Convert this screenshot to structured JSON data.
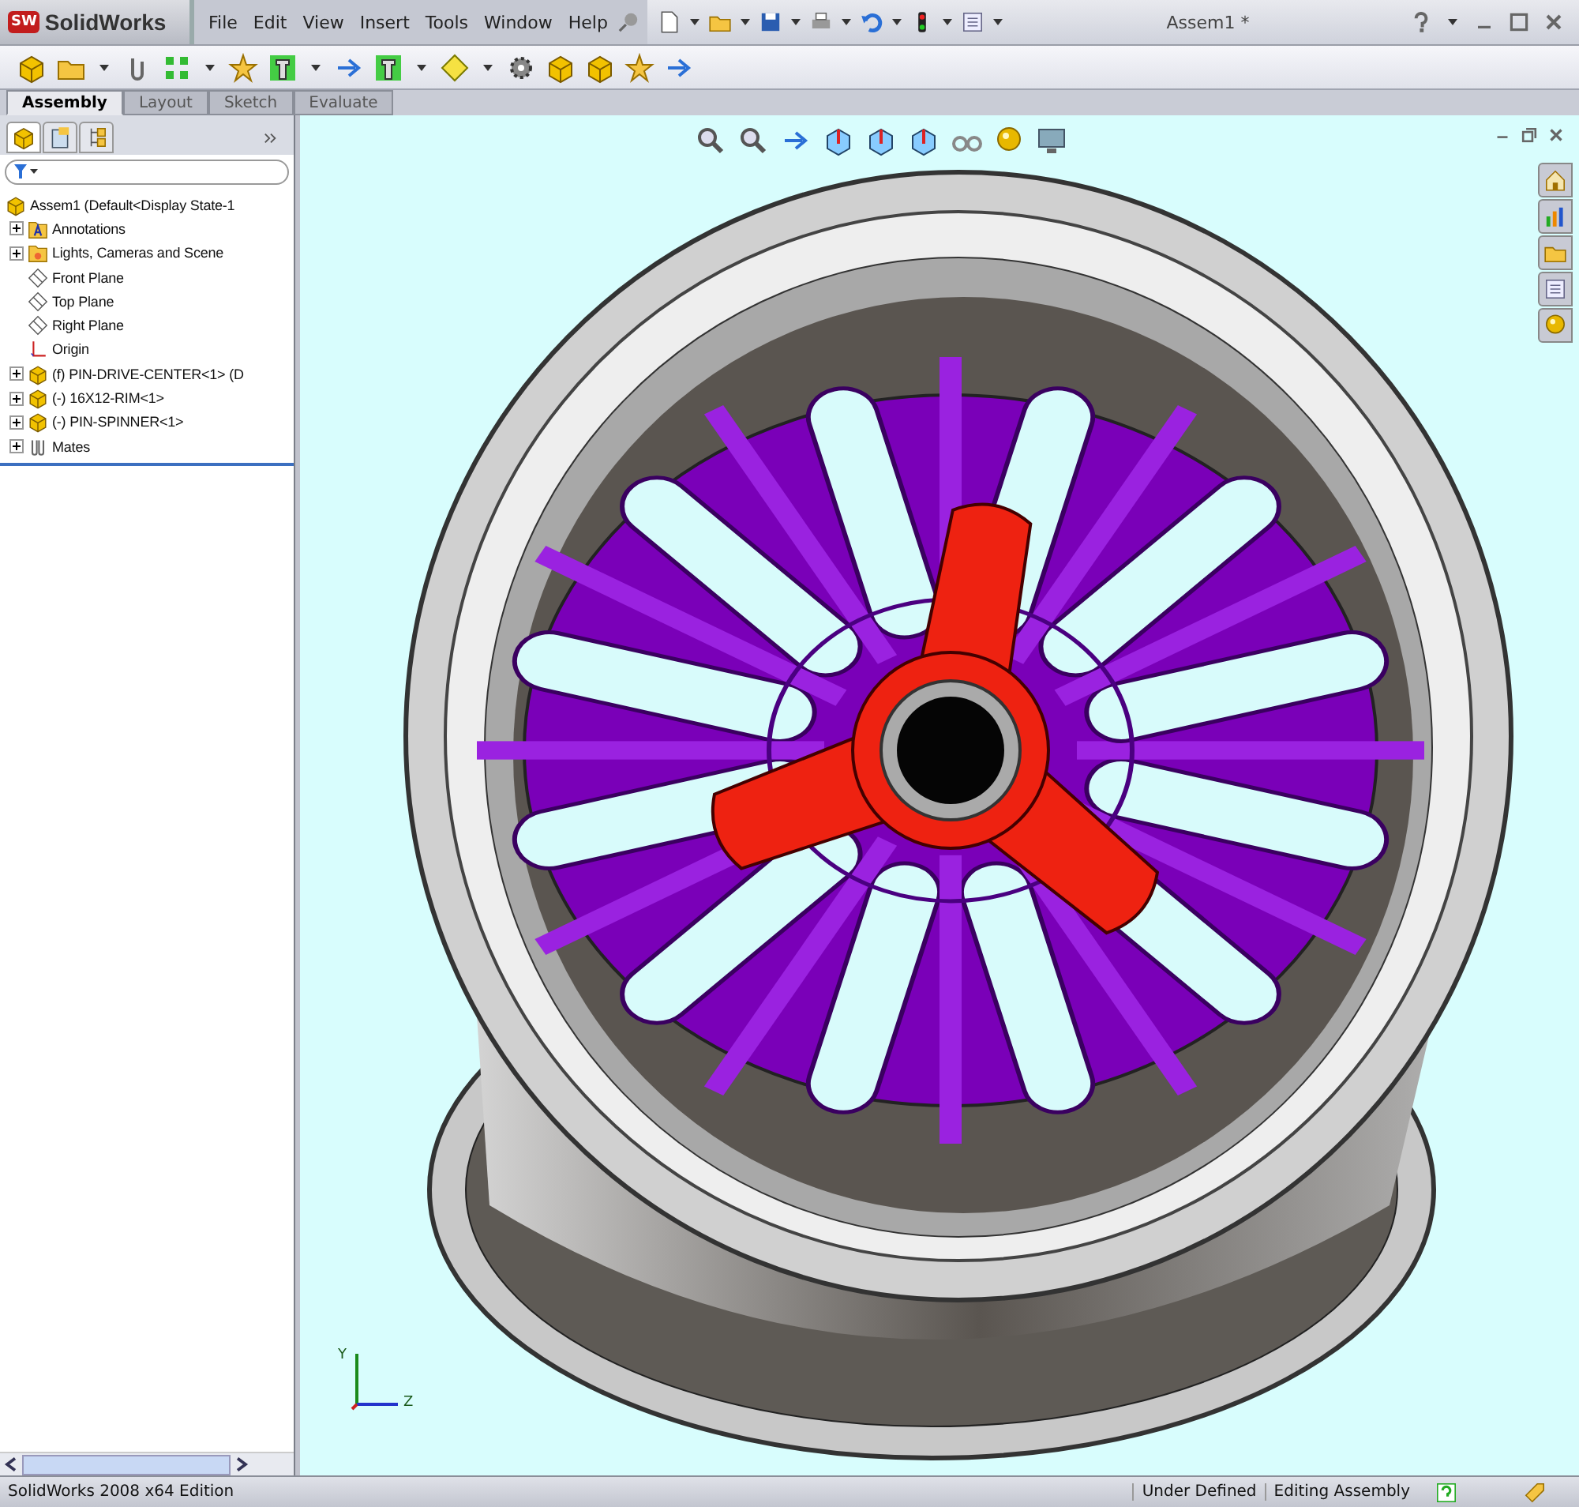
{
  "app": {
    "logo": "SW",
    "name": "SolidWorks"
  },
  "menu": [
    "File",
    "Edit",
    "View",
    "Insert",
    "Tools",
    "Window",
    "Help"
  ],
  "document_title": "Assem1 *",
  "command_tabs": [
    {
      "label": "Assembly",
      "selected": true
    },
    {
      "label": "Layout",
      "selected": false
    },
    {
      "label": "Sketch",
      "selected": false
    },
    {
      "label": "Evaluate",
      "selected": false
    }
  ],
  "panel_tabs": [
    {
      "kind": "tree",
      "selected": true
    },
    {
      "kind": "properties",
      "selected": false
    },
    {
      "kind": "config",
      "selected": false
    }
  ],
  "tree": {
    "label": "Assem1  (Default<Display State-1",
    "children": [
      {
        "kind": "annotations",
        "label": "Annotations",
        "expanded": false
      },
      {
        "kind": "lights",
        "label": "Lights, Cameras and Scene",
        "expanded": false
      },
      {
        "kind": "plane",
        "label": "Front Plane"
      },
      {
        "kind": "plane",
        "label": "Top Plane"
      },
      {
        "kind": "plane",
        "label": "Right Plane"
      },
      {
        "kind": "origin",
        "label": "Origin"
      },
      {
        "kind": "part",
        "label": "(f) PIN-DRIVE-CENTER<1> (D",
        "expanded": false
      },
      {
        "kind": "part",
        "label": "(-) 16X12-RIM<1>",
        "expanded": false
      },
      {
        "kind": "part",
        "label": "(-) PIN-SPINNER<1>",
        "expanded": false
      },
      {
        "kind": "mates",
        "label": "Mates",
        "expanded": false
      }
    ]
  },
  "triad": {
    "y": "Y",
    "z": "Z"
  },
  "status_bar": {
    "edition": "SolidWorks 2008 x64 Edition",
    "state": "Under Defined",
    "mode": "Editing Assembly"
  }
}
